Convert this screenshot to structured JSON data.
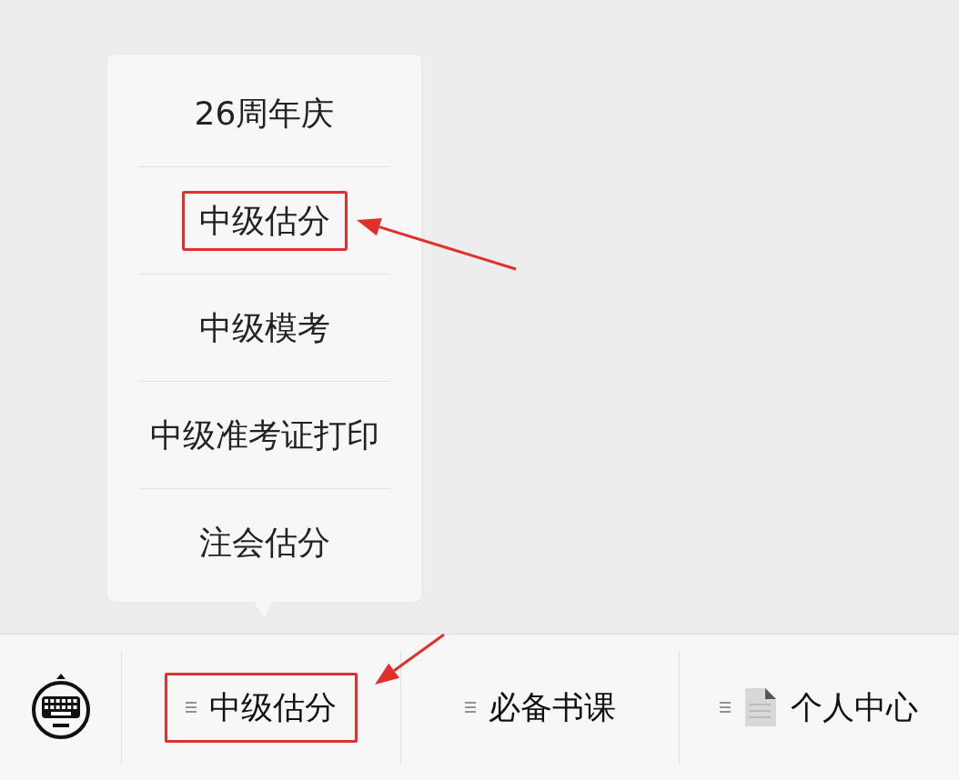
{
  "menu": {
    "items": [
      {
        "label": "26周年庆",
        "annotated": false
      },
      {
        "label": "中级估分",
        "annotated": true
      },
      {
        "label": "中级模考",
        "annotated": false
      },
      {
        "label": "中级准考证打印",
        "annotated": false
      },
      {
        "label": "注会估分",
        "annotated": false
      }
    ]
  },
  "bottom_bar": {
    "tabs": [
      {
        "label": "中级估分",
        "kind": "plain",
        "annotated": true
      },
      {
        "label": "必备书课",
        "kind": "plain",
        "annotated": false
      },
      {
        "label": "个人中心",
        "kind": "with-image",
        "annotated": false
      }
    ]
  }
}
